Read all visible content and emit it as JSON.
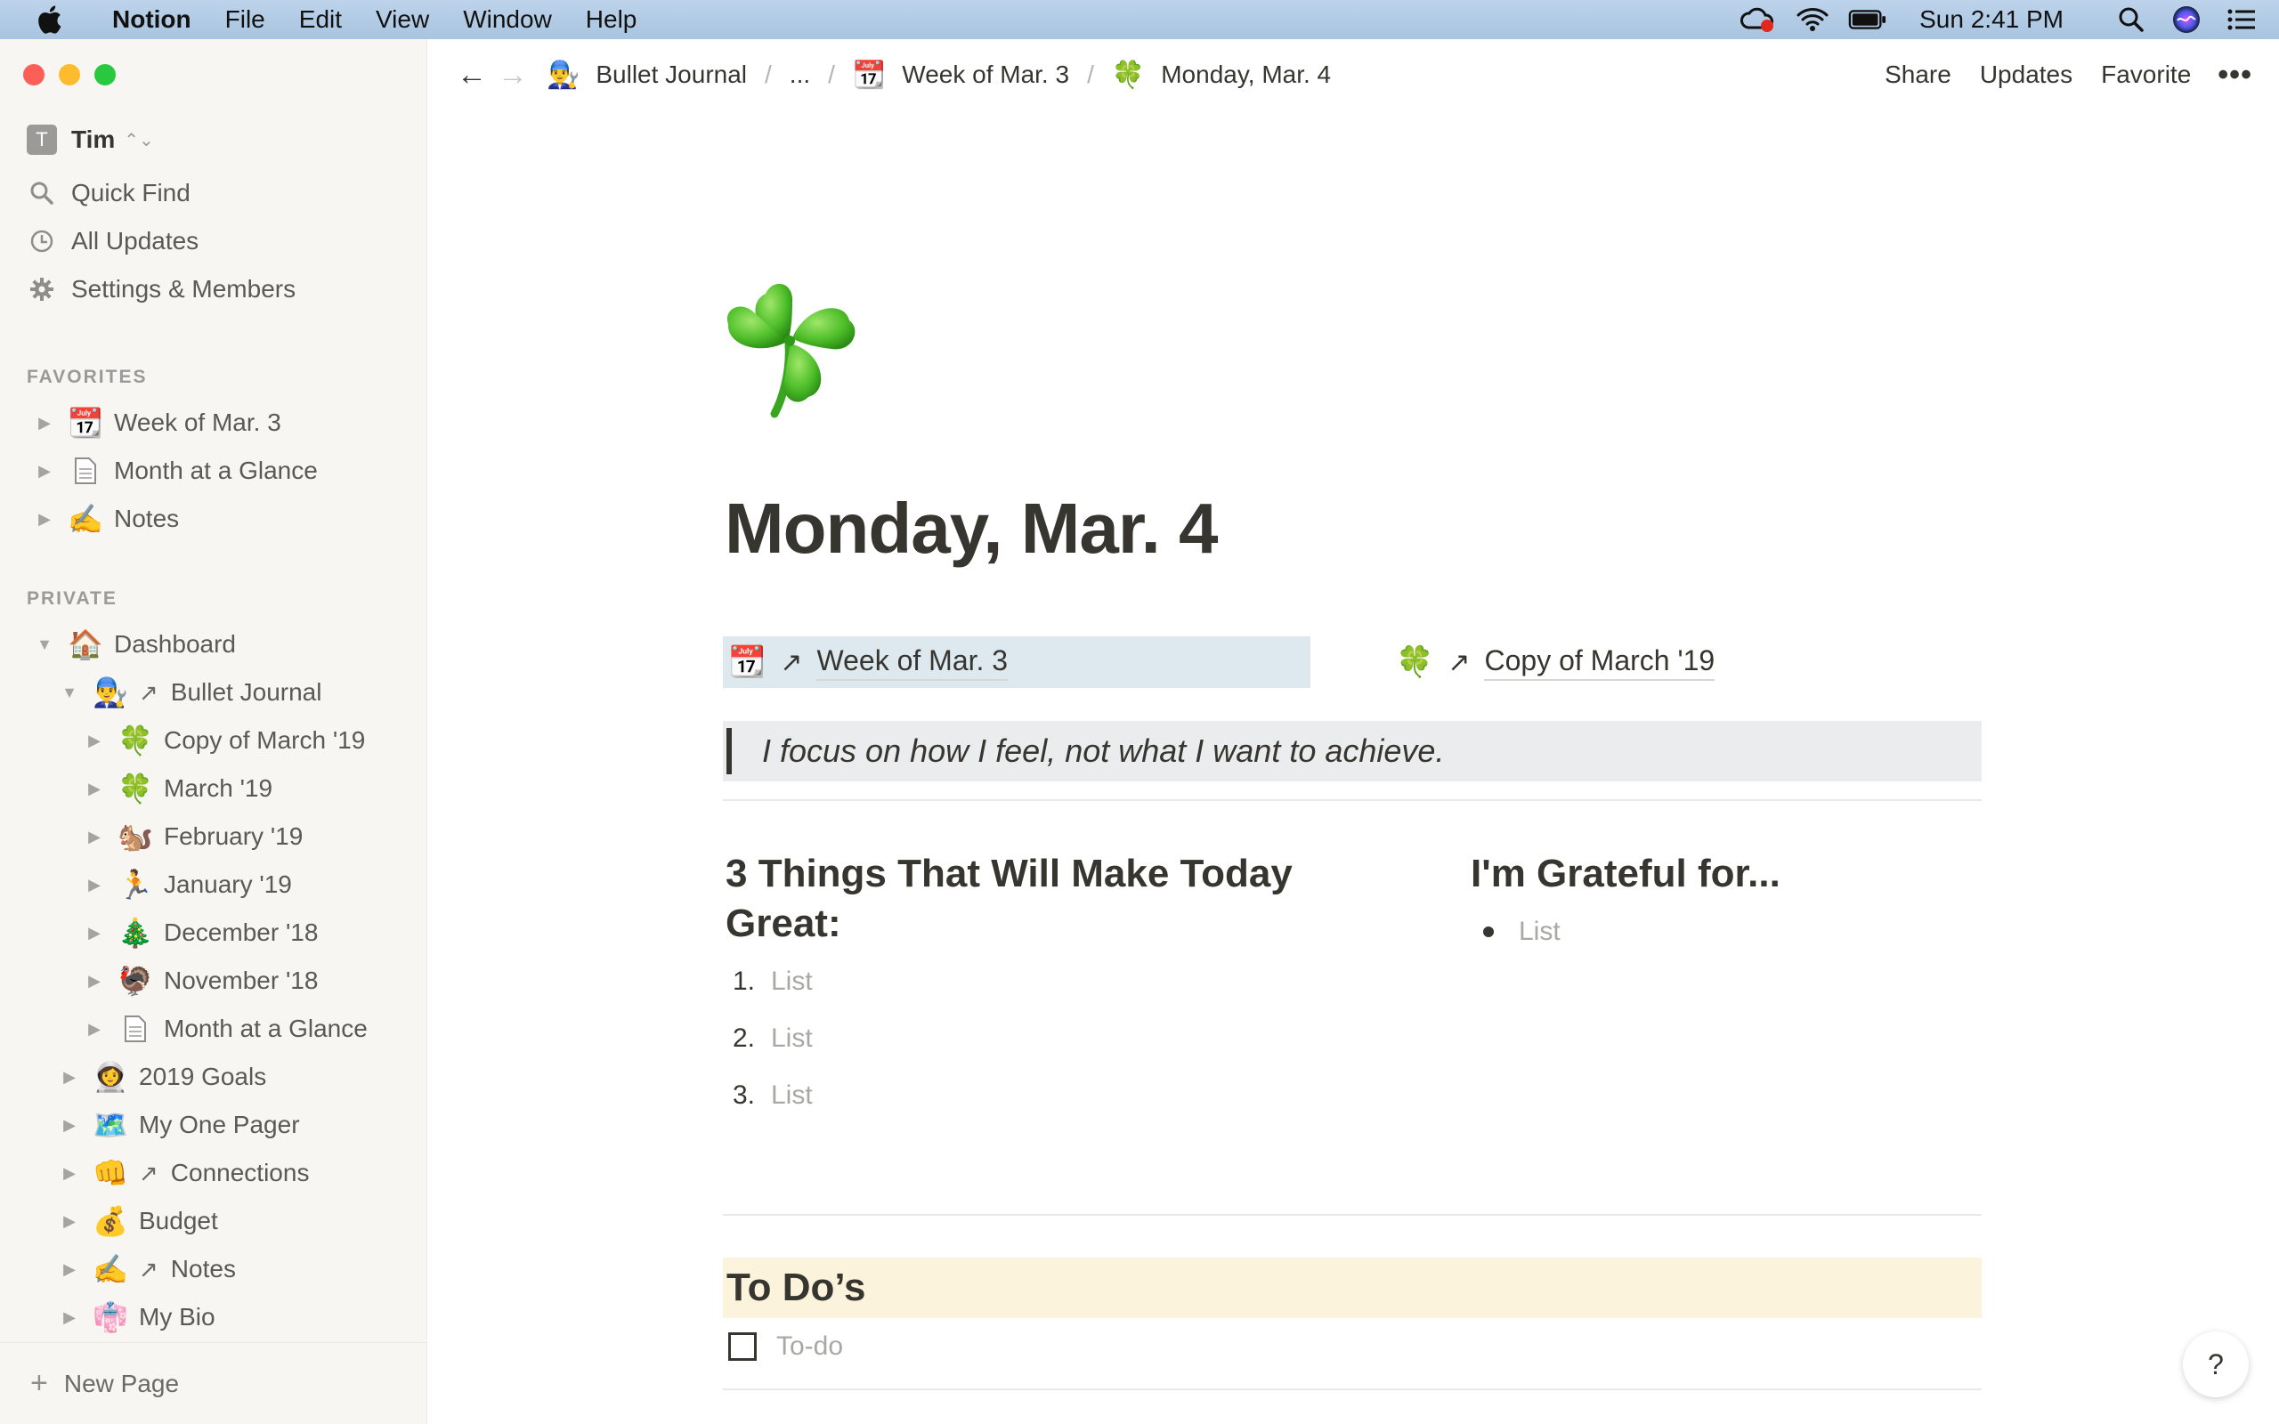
{
  "menubar": {
    "app_name": "Notion",
    "menus": [
      "File",
      "Edit",
      "View",
      "Window",
      "Help"
    ],
    "clock": "Sun 2:41 PM"
  },
  "sidebar": {
    "workspace_initial": "T",
    "workspace_name": "Tim",
    "quick_find": "Quick Find",
    "all_updates": "All Updates",
    "settings": "Settings & Members",
    "favorites_label": "FAVORITES",
    "favorites": [
      {
        "label": "Week of Mar. 3",
        "emoji": "📆"
      },
      {
        "label": "Month at a Glance",
        "emoji": "page"
      },
      {
        "label": "Notes",
        "emoji": "✍️"
      }
    ],
    "private_label": "PRIVATE",
    "private": [
      {
        "label": "Dashboard",
        "emoji": "🏠",
        "level": 0,
        "expanded": true
      },
      {
        "label": "Bullet Journal",
        "emoji": "👨‍🔧",
        "level": 1,
        "expanded": true,
        "link": true
      },
      {
        "label": "Copy of March '19",
        "emoji": "🍀",
        "level": 2
      },
      {
        "label": "March '19",
        "emoji": "🍀",
        "level": 2
      },
      {
        "label": "February '19",
        "emoji": "🐿️",
        "level": 2
      },
      {
        "label": "January '19",
        "emoji": "🏃",
        "level": 2
      },
      {
        "label": "December '18",
        "emoji": "🎄",
        "level": 2
      },
      {
        "label": "November '18",
        "emoji": "🦃",
        "level": 2
      },
      {
        "label": "Month at a Glance",
        "emoji": "page",
        "level": 2
      },
      {
        "label": "2019 Goals",
        "emoji": "👩‍🚀",
        "level": 1
      },
      {
        "label": "My One Pager",
        "emoji": "🗺️",
        "level": 1
      },
      {
        "label": "Connections",
        "emoji": "👊",
        "level": 1,
        "link": true
      },
      {
        "label": "Budget",
        "emoji": "💰",
        "level": 1
      },
      {
        "label": "Notes",
        "emoji": "✍️",
        "level": 1,
        "link": true
      },
      {
        "label": "My Bio",
        "emoji": "👘",
        "level": 1
      }
    ],
    "new_page": "New Page"
  },
  "topbar": {
    "breadcrumbs": [
      {
        "label": "Bullet Journal",
        "emoji": "👨‍🔧"
      },
      {
        "label": "...",
        "emoji": ""
      },
      {
        "label": "Week of Mar. 3",
        "emoji": "📆"
      },
      {
        "label": "Monday, Mar. 4",
        "emoji": "🍀"
      }
    ],
    "share": "Share",
    "updates": "Updates",
    "favorite": "Favorite",
    "more": "•••"
  },
  "page": {
    "icon": "four-leaf-clover",
    "title": "Monday, Mar. 4",
    "link_left": {
      "emoji": "📆",
      "label": "Week of Mar. 3"
    },
    "link_right": {
      "emoji": "🍀",
      "label": "Copy of March '19"
    },
    "quote": "I focus on how I feel, not what I want to achieve.",
    "col_left": {
      "heading": "3 Things That Will Make Today Great:",
      "items": [
        {
          "num": "1.",
          "text": "List"
        },
        {
          "num": "2.",
          "text": "List"
        },
        {
          "num": "3.",
          "text": "List"
        }
      ]
    },
    "col_right": {
      "heading": "I'm Grateful for...",
      "items": [
        {
          "text": "List"
        }
      ]
    },
    "todo_heading": "To Do’s",
    "todo_placeholder": "To-do",
    "help": "?"
  },
  "colors": {
    "sidebar_bg": "#f7f6f3",
    "link_highlight": "#dde8ef",
    "quote_bg": "#ebeced",
    "todo_heading_bg": "#fbf3db",
    "text": "#37352f"
  }
}
